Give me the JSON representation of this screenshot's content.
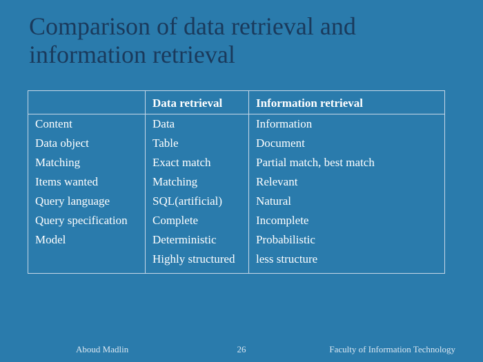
{
  "title": "Comparison of data retrieval and information retrieval",
  "table": {
    "headers": [
      "",
      "Data retrieval",
      "Information retrieval"
    ],
    "rows": [
      [
        "Content",
        "Data",
        "Information"
      ],
      [
        "Data object",
        "Table",
        "Document"
      ],
      [
        "Matching",
        "Exact match",
        "Partial match, best match"
      ],
      [
        "Items wanted",
        "Matching",
        "Relevant"
      ],
      [
        "Query language",
        "SQL(artificial)",
        "Natural"
      ],
      [
        "Query specification",
        "Complete",
        "Incomplete"
      ],
      [
        "Model",
        "Deterministic",
        "Probabilistic"
      ],
      [
        "",
        "Highly structured",
        "less structure"
      ]
    ]
  },
  "footer": {
    "author": "Aboud Madlin",
    "page": "26",
    "affil": "Faculty of Information Technology"
  }
}
